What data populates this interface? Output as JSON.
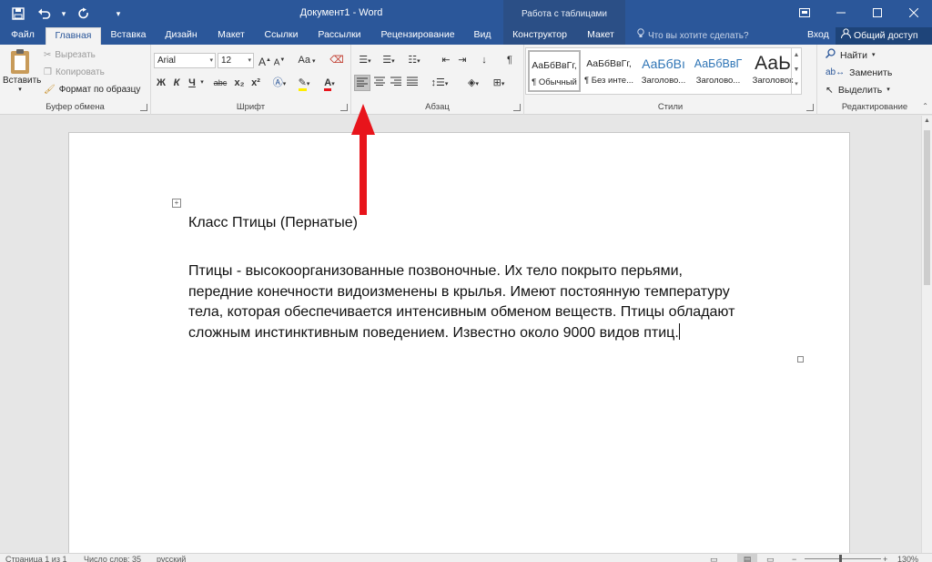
{
  "window": {
    "title": "Документ1 - Word",
    "contextual_group": "Работа с таблицами"
  },
  "quick_access": {
    "save_icon": "save-icon",
    "undo_icon": "undo-icon",
    "redo_icon": "redo-icon",
    "customize_icon": "customize-qat-icon"
  },
  "window_controls": {
    "ribbon_options_icon": "ribbon-display-options-icon",
    "minimize_icon": "minimize-icon",
    "restore_icon": "restore-icon",
    "close_icon": "close-icon"
  },
  "tabs": [
    {
      "label": "Файл"
    },
    {
      "label": "Главная"
    },
    {
      "label": "Вставка"
    },
    {
      "label": "Дизайн"
    },
    {
      "label": "Макет"
    },
    {
      "label": "Ссылки"
    },
    {
      "label": "Рассылки"
    },
    {
      "label": "Рецензирование"
    },
    {
      "label": "Вид"
    },
    {
      "label": "Конструктор"
    },
    {
      "label": "Макет"
    }
  ],
  "active_tab": "Главная",
  "tell_me": {
    "placeholder": "Что вы хотите сделать?",
    "icon": "lightbulb-icon"
  },
  "sign_in": "Вход",
  "share": {
    "label": "Общий доступ",
    "icon": "person-icon"
  },
  "clipboard": {
    "paste": "Вставить",
    "cut": "Вырезать",
    "copy": "Копировать",
    "format_painter": "Формат по образцу",
    "label": "Буфер обмена"
  },
  "font": {
    "name": "Arial",
    "size": "12",
    "grow_label": "A",
    "shrink_label": "A",
    "case_label": "Aa",
    "bold": "Ж",
    "italic": "К",
    "underline": "Ч",
    "strike": "abc",
    "subscript": "x₂",
    "superscript": "x²",
    "label": "Шрифт"
  },
  "paragraph": {
    "label": "Абзац",
    "show_marks": "¶"
  },
  "styles": {
    "items": [
      {
        "preview": "АаБбВвГг,",
        "name": "¶ Обычный"
      },
      {
        "preview": "АаБбВвГг,",
        "name": "¶ Без инте..."
      },
      {
        "preview": "АаБбВı",
        "name": "Заголово..."
      },
      {
        "preview": "АаБбВвГ",
        "name": "Заголово..."
      },
      {
        "preview": "АаЬ",
        "name": "Заголовок"
      }
    ],
    "label": "Стили"
  },
  "editing": {
    "find": "Найти",
    "replace": "Заменить",
    "select": "Выделить",
    "label": "Редактирование"
  },
  "document": {
    "heading": "Класс Птицы (Пернатые)",
    "lines": [
      "Птицы - высокоорганизованные позвоночные. Их тело покрыто перьями,",
      "передние конечности видоизменены в крылья. Имеют постоянную температуру",
      "тела, которая обеспечивается интенсивным обменом веществ. Птицы обладают",
      "сложным инстинктивным поведением. Известно около 9000 видов птиц."
    ]
  },
  "status": {
    "page": "Страница 1 из 1",
    "words": "Число слов: 35",
    "language": "русский",
    "zoom": "130%"
  },
  "colors": {
    "accent": "#2b579a",
    "arrow": "#e8141b"
  }
}
